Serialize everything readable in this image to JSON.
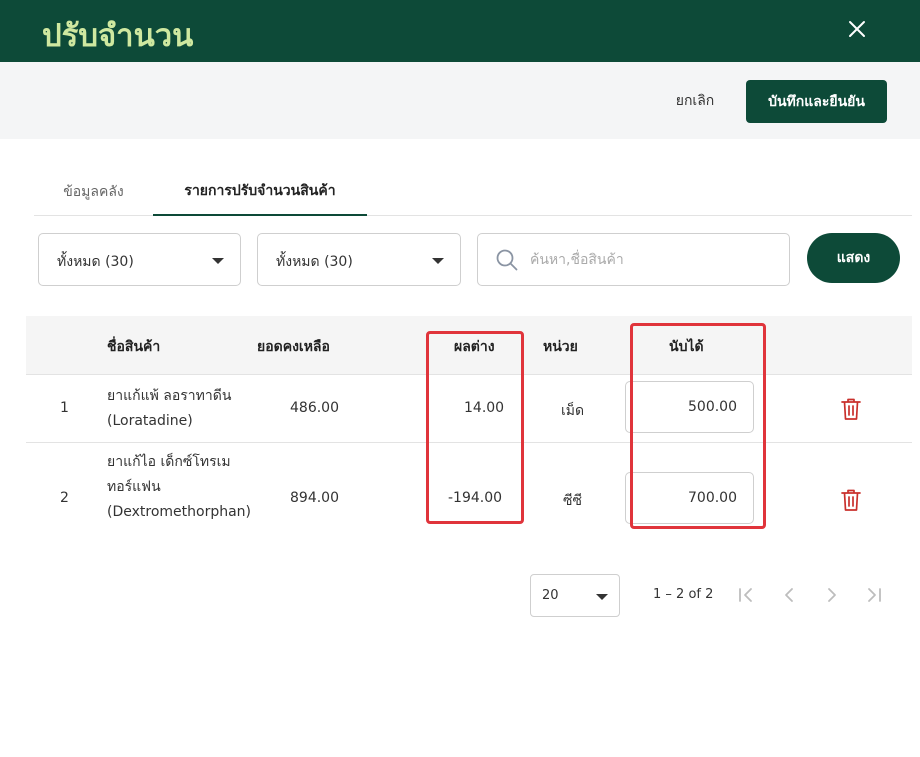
{
  "header": {
    "title": "ปรับจำนวน",
    "close_icon": "close-icon"
  },
  "actions": {
    "cancel_label": "ยกเลิก",
    "save_label": "บันทึกและยืนยัน"
  },
  "tabs": [
    {
      "label": "ข้อมูลคลัง",
      "active": false
    },
    {
      "label": "รายการปรับจำนวนสินค้า",
      "active": true
    }
  ],
  "filters": {
    "select1": "ทั้งหมด (30)",
    "select2": "ทั้งหมด (30)",
    "search_placeholder": "ค้นหา,ชื่อสินค้า",
    "show_label": "แสดง"
  },
  "table": {
    "headers": {
      "name": "ชื่อสินค้า",
      "balance": "ยอดคงเหลือ",
      "diff": "ผลต่าง",
      "unit": "หน่วย",
      "counted": "นับได้"
    },
    "rows": [
      {
        "no": "1",
        "name": "ยาแก้แพ้ ลอราทาดีน (Loratadine)",
        "balance": "486.00",
        "diff": "14.00",
        "unit": "เม็ด",
        "counted": "500.00"
      },
      {
        "no": "2",
        "name": "ยาแก้ไอ เด็กซ์โทรเมทอร์แฟน (Dextromethorphan)",
        "balance": "894.00",
        "diff": "-194.00",
        "unit": "ซีซี",
        "counted": "700.00"
      }
    ]
  },
  "paginator": {
    "page_size": "20",
    "range": "1 – 2 of 2"
  },
  "colors": {
    "brand": "#0d4a38",
    "title": "#cfe8a0",
    "highlight": "#e0343b",
    "delete": "#c9302c"
  }
}
